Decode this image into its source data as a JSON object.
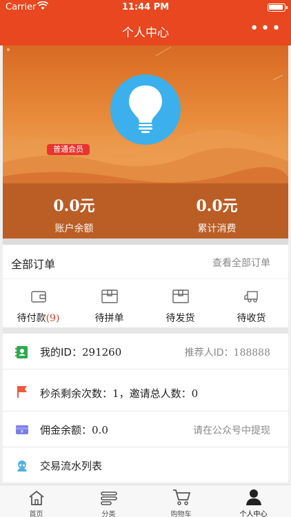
{
  "status_bar": {
    "carrier": "Carrier",
    "time": "11:44 PM"
  },
  "nav": {
    "title": "个人中心",
    "more": "•••"
  },
  "profile": {
    "member_badge": "普通会员",
    "balance_value": "0.0元",
    "balance_label": "账户余额",
    "spend_value": "0.0元",
    "spend_label": "累计消费",
    "avatar_icon": "lightbulb-icon"
  },
  "orders": {
    "title": "全部订单",
    "view_all": "查看全部订单",
    "items": [
      {
        "label": "待付款",
        "count": "(9)",
        "icon": "wallet-icon"
      },
      {
        "label": "待拼单",
        "count": "",
        "icon": "box-icon"
      },
      {
        "label": "待发货",
        "count": "",
        "icon": "box-icon"
      },
      {
        "label": "待收货",
        "count": "",
        "icon": "truck-icon"
      }
    ]
  },
  "info_rows": {
    "my_id_label": "我的ID：",
    "my_id_value": "291260",
    "referrer_label": "推荐人ID：",
    "referrer_value": "188888",
    "flash_label": "秒杀剩余次数：",
    "flash_value": "1",
    "invite_label": "，邀请总人数：",
    "invite_value": "0",
    "commission_label": "佣金余额：",
    "commission_value": "0.0",
    "withdraw_hint": "请在公众号中提现",
    "transactions_label": "交易流水列表"
  },
  "tabbar": {
    "items": [
      {
        "label": "首页",
        "icon": "home-icon"
      },
      {
        "label": "分类",
        "icon": "category-icon"
      },
      {
        "label": "购物车",
        "icon": "cart-icon"
      },
      {
        "label": "个人中心",
        "icon": "user-icon"
      }
    ]
  },
  "colors": {
    "brand": "#e8471f",
    "avatar_bg": "#3bb0ec",
    "badge": "#e8352f",
    "count": "#d43b2b"
  }
}
